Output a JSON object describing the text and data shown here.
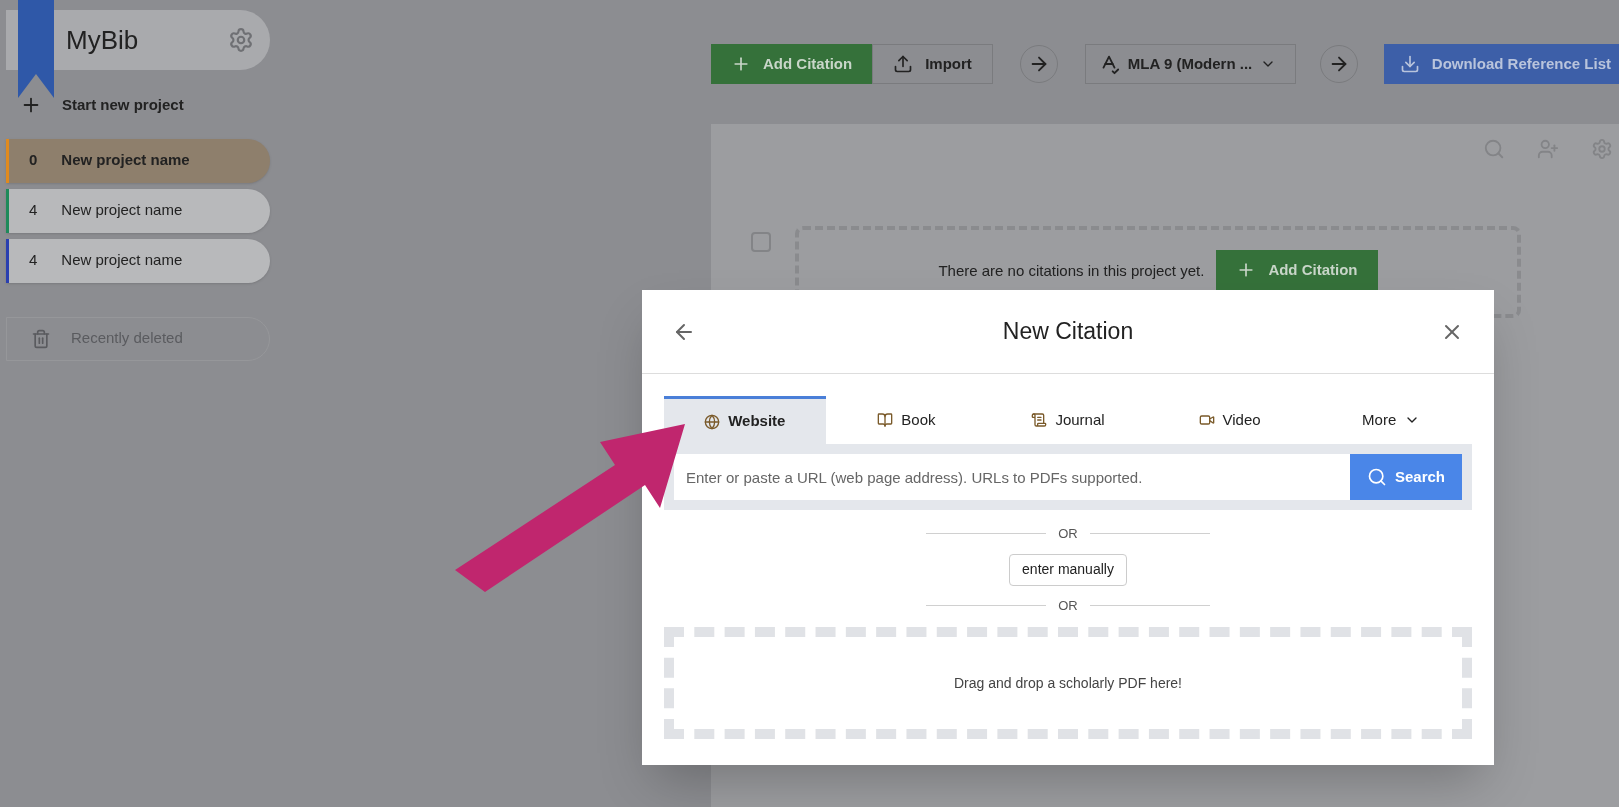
{
  "app": {
    "name": "MyBib"
  },
  "sidebar": {
    "new_project": "Start new project",
    "projects": [
      {
        "count": "0",
        "name": "New project name",
        "color": "#e08a1e",
        "selected": true
      },
      {
        "count": "4",
        "name": "New project name",
        "color": "#1e8a5a",
        "selected": false
      },
      {
        "count": "4",
        "name": "New project name",
        "color": "#2a3fb0",
        "selected": false
      }
    ],
    "recently_deleted": {
      "label": "Recently deleted",
      "disabled": true
    }
  },
  "toolbar": {
    "add_citation": "Add Citation",
    "import": "Import",
    "style": "MLA 9 (Modern ...",
    "download": "Download Reference List"
  },
  "project": {
    "select_all": {
      "checked": false
    },
    "empty_message": "There are no citations in this project yet.",
    "add_citation": "Add Citation"
  },
  "dialog": {
    "title": "New Citation",
    "tabs": [
      {
        "label": "Website",
        "kind": "website",
        "selected": true
      },
      {
        "label": "Book",
        "kind": "book",
        "selected": false
      },
      {
        "label": "Journal",
        "kind": "journal",
        "selected": false
      },
      {
        "label": "Video",
        "kind": "video",
        "selected": false
      },
      {
        "label": "More",
        "kind": "menu",
        "selected": false
      }
    ],
    "search": {
      "placeholder": "Enter or paste a URL (web page address). URLs to PDFs supported.",
      "button": "Search"
    },
    "separators": [
      "OR",
      "OR"
    ],
    "manual_button": "enter manually",
    "dropzone": "Drag and drop a scholarly PDF here!"
  }
}
